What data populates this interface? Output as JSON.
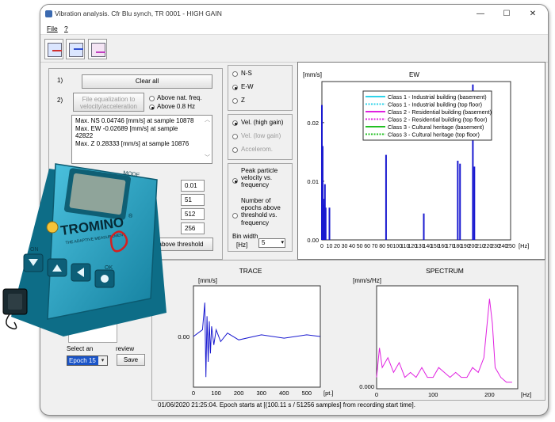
{
  "window": {
    "title": "Vibration analysis. Cfr Blu synch, TR 0001 - HIGH GAIN",
    "minimize": "—",
    "maximize": "☐",
    "close": "✕",
    "menu": [
      "File",
      "?"
    ]
  },
  "left_panel": {
    "step1": "1)",
    "clear_all": "Clear all",
    "step2": "2)",
    "file_eq_line1": "File equalization to",
    "file_eq_line2": "velocity/acceleration",
    "above_nat_freq": "Above nat. freq.",
    "above_08": "Above 0.8 Hz",
    "maxima": [
      "Max. NS 0.04746 [mm/s]   at sample  10878",
      "Max. EW -0.02689 [mm/s]   at sample",
      "42822",
      "Max. Z 0.28333 [mm/s]   at sample  10876"
    ],
    "param_values": [
      "0.01",
      "51",
      "512",
      "256"
    ],
    "threshold_button": "above threshold",
    "select_epoch_label_a": "Select an",
    "select_epoch_label_b": "review",
    "epoch_value": "Epoch 15",
    "save": "Save"
  },
  "axis_options": {
    "ns": "N-S",
    "ew": "E-W",
    "z": "Z"
  },
  "sensor_options": {
    "vel_high": "Vel. (high gain)",
    "vel_low": "Vel. (low gain)",
    "accel": "Accelerom."
  },
  "mode_options": {
    "ppv": "Peak particle velocity vs. frequency",
    "epochs": "Number of epochs above threshold vs. frequency",
    "bin_width_label_1": "Bin width",
    "bin_width_label_2": "[Hz]",
    "bin_width_value": "5"
  },
  "ew_chart": {
    "title": "EW",
    "ylabel": "[mm/s]",
    "xunit": "[Hz]",
    "yticks": [
      "0.02",
      "0.01",
      "0.00"
    ],
    "xticks": [
      "0",
      "10",
      "20",
      "30",
      "40",
      "50",
      "60",
      "70",
      "80",
      "90",
      "100",
      "110",
      "120",
      "130",
      "140",
      "150",
      "160",
      "170",
      "180",
      "190",
      "200",
      "210",
      "220",
      "230",
      "240",
      "250"
    ],
    "legend": [
      {
        "label": "Class 1 - Industrial building (basement)",
        "color": "#2ed3ea",
        "dash": false
      },
      {
        "label": "Class 1 - Industrial building (top floor)",
        "color": "#2ed3ea",
        "dash": true
      },
      {
        "label": "Class 2 - Residential building (basement)",
        "color": "#e020e0",
        "dash": false
      },
      {
        "label": "Class 2 - Residential building (top floor)",
        "color": "#e020e0",
        "dash": true
      },
      {
        "label": "Class 3 - Cultural heritage (basement)",
        "color": "#22c022",
        "dash": false
      },
      {
        "label": "Class 3 - Cultural heritage (top floor)",
        "color": "#22c022",
        "dash": true
      }
    ],
    "bar_color": "#1a1ad0"
  },
  "trace_chart": {
    "title": "TRACE",
    "ylabel": "[mm/s]",
    "ytick": "0.00",
    "xticks": [
      "0",
      "100",
      "200",
      "300",
      "400",
      "500"
    ],
    "xunit": "[pt.]",
    "color": "#1a1ad0"
  },
  "spectrum_chart": {
    "title": "SPECTRUM",
    "ylabel": "[mm/s/Hz]",
    "ytick": "0.000",
    "xticks": [
      "0",
      "100",
      "200"
    ],
    "xunit": "[Hz]",
    "color": "#e020e0"
  },
  "status": "01/06/2020 21:25:04. Epoch starts at [(100.11 s / 51256 samples] from recording start time].",
  "device": {
    "brand": "TROMINO",
    "registered": "®",
    "tagline": "THE ADAPTIVE MEASUREMENT",
    "mode_label": "MODE",
    "ok_label": "OK",
    "on_label": "ON",
    "body_color": "#1ea2c4"
  },
  "chart_data": [
    {
      "type": "bar",
      "title": "EW",
      "ylabel": "[mm/s]",
      "xlabel": "[Hz]",
      "x": [
        0,
        1,
        2,
        3,
        4,
        5,
        10,
        85,
        135,
        180,
        183,
        200,
        202
      ],
      "values": [
        0.023,
        0.016,
        0.007,
        0.006,
        0.0095,
        0.0055,
        0.0055,
        0.0145,
        0.0045,
        0.0135,
        0.013,
        0.0265,
        0.0125
      ],
      "xlim": [
        0,
        250
      ],
      "ylim": [
        0,
        0.027
      ]
    },
    {
      "type": "line",
      "title": "TRACE",
      "ylabel": "[mm/s]",
      "xlabel": "[pt.]",
      "xlim": [
        0,
        560
      ],
      "series": [
        {
          "x": [
            0,
            20,
            40,
            50,
            55,
            60,
            65,
            70,
            75,
            80,
            90,
            100,
            120,
            150,
            200,
            300,
            400,
            500,
            560
          ],
          "values": [
            0.0,
            0.002,
            0.004,
            0.02,
            -0.024,
            0.012,
            -0.015,
            0.009,
            -0.01,
            0.006,
            -0.005,
            0.004,
            -0.003,
            0.002,
            -0.002,
            0.001,
            -0.001,
            0.001,
            0.0
          ]
        }
      ]
    },
    {
      "type": "line",
      "title": "SPECTRUM",
      "ylabel": "[mm/s/Hz]",
      "xlabel": "[Hz]",
      "xlim": [
        0,
        250
      ],
      "series": [
        {
          "x": [
            0,
            5,
            10,
            20,
            30,
            40,
            50,
            60,
            70,
            80,
            90,
            100,
            110,
            120,
            130,
            140,
            150,
            160,
            170,
            180,
            190,
            200,
            205,
            210,
            220,
            230,
            240
          ],
          "values": [
            0.002,
            0.008,
            0.004,
            0.006,
            0.003,
            0.005,
            0.002,
            0.003,
            0.002,
            0.004,
            0.002,
            0.002,
            0.004,
            0.003,
            0.002,
            0.003,
            0.002,
            0.002,
            0.004,
            0.003,
            0.006,
            0.018,
            0.013,
            0.004,
            0.002,
            0.001,
            0.001
          ]
        }
      ]
    }
  ]
}
